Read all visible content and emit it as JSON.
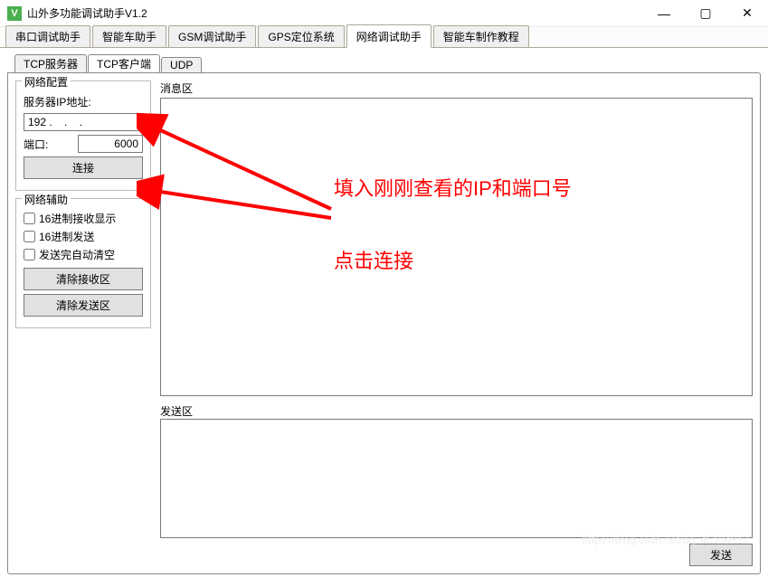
{
  "window": {
    "title": "山外多功能调试助手V1.2",
    "icon_letter": "V"
  },
  "main_tabs": [
    "串口调试助手",
    "智能车助手",
    "GSM调试助手",
    "GPS定位系统",
    "网络调试助手",
    "智能车制作教程"
  ],
  "main_tab_active_index": 4,
  "inner_tabs": [
    "TCP服务器",
    "TCP客户端",
    "UDP"
  ],
  "inner_tab_active_index": 1,
  "net_config": {
    "legend": "网络配置",
    "ip_label": "服务器IP地址:",
    "ip_value": "192 .    .    .    ",
    "port_label": "端口:",
    "port_value": "6000",
    "connect_btn": "连接"
  },
  "net_assist": {
    "legend": "网络辅助",
    "hex_recv": "16进制接收显示",
    "hex_send": "16进制发送",
    "auto_clear": "发送完自动清空",
    "clear_recv": "清除接收区",
    "clear_send": "清除发送区"
  },
  "msg_area_label": "消息区",
  "send_area_label": "发送区",
  "send_btn": "发送",
  "annotation1": "填入刚刚查看的IP和端口号",
  "annotation2": "点击连接",
  "watermark": "https://blog.csdn.net/qq_45104817"
}
